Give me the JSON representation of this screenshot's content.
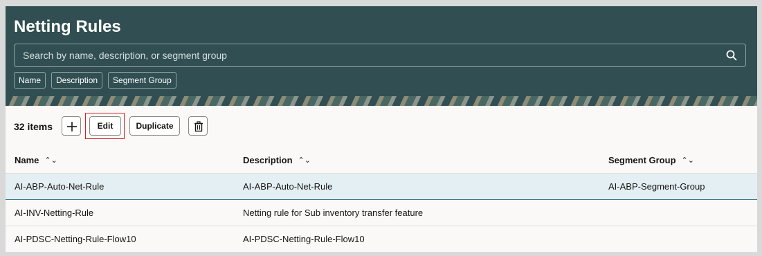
{
  "header": {
    "title": "Netting Rules",
    "search_placeholder": "Search by name, description, or segment group",
    "chips": [
      "Name",
      "Description",
      "Segment Group"
    ]
  },
  "toolbar": {
    "count": "32 items",
    "edit_label": "Edit",
    "duplicate_label": "Duplicate",
    "add_icon": "plus-icon",
    "delete_icon": "trash-icon"
  },
  "table": {
    "columns": [
      "Name",
      "Description",
      "Segment Group"
    ],
    "rows": [
      {
        "name": "AI-ABP-Auto-Net-Rule",
        "description": "AI-ABP-Auto-Net-Rule",
        "segment_group": "AI-ABP-Segment-Group"
      },
      {
        "name": "AI-INV-Netting-Rule",
        "description": "Netting rule for Sub inventory transfer feature",
        "segment_group": ""
      },
      {
        "name": "AI-PDSC-Netting-Rule-Flow10",
        "description": "AI-PDSC-Netting-Rule-Flow10",
        "segment_group": ""
      }
    ]
  },
  "colors": {
    "header_bg": "#314f52",
    "selected_row": "#e4eff3",
    "focus_outline": "#c62424"
  }
}
